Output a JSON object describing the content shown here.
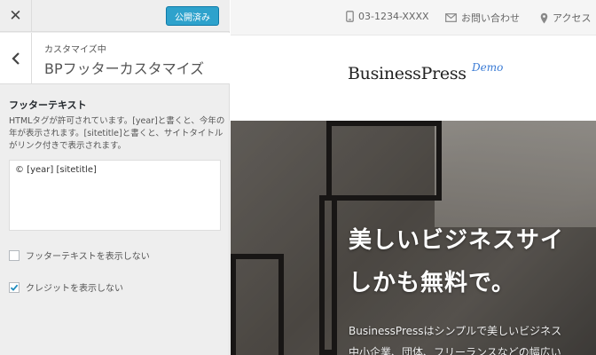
{
  "panel": {
    "close_label": "✕",
    "publish_label": "公開済み",
    "breadcrumb": "カスタマイズ中",
    "section_title": "BPフッターカスタマイズ",
    "control_label": "フッターテキスト",
    "control_description": "HTMLタグが許可されています。[year]と書くと、今年の年が表示されます。[sitetitle]と書くと、サイトタイトルがリンク付きで表示されます。",
    "textarea_value": "© [year] [sitetitle]",
    "checkboxes": [
      {
        "label": "フッターテキストを表示しない",
        "checked": false
      },
      {
        "label": "クレジットを表示しない",
        "checked": true
      }
    ]
  },
  "preview": {
    "phone": "03-1234-XXXX",
    "contact_label": "お問い合わせ",
    "access_label": "アクセス",
    "logo_text": "BusinessPress",
    "logo_badge": "Demo",
    "hero_line1": "美しいビジネスサイ",
    "hero_line2": "しかも無料で。",
    "hero_text1": "BusinessPressはシンプルで美しいビジネス",
    "hero_text2": "中小企業、団体、フリーランスなどの幅広い"
  },
  "colors": {
    "publish_button": "#2ea2cc",
    "panel_background": "#eeeeee",
    "checkmark": "#1e8cbe",
    "logo_badge": "#3a7bd5"
  },
  "icons": [
    "close-icon",
    "chevron-left-icon",
    "phone-icon",
    "mail-icon",
    "map-pin-icon",
    "checkmark-icon"
  ]
}
